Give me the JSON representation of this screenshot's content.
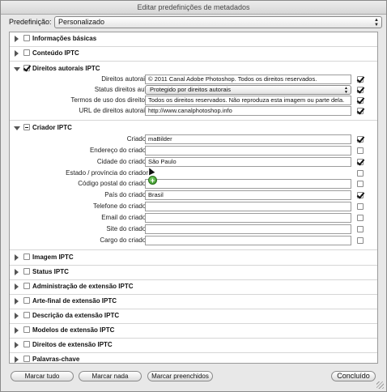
{
  "window": {
    "title": "Editar predefinições de metadados"
  },
  "preset": {
    "label": "Predefinição:",
    "value": "Personalizado"
  },
  "sections_top": [
    {
      "title": "Informações básicas"
    },
    {
      "title": "Conteúdo IPTC"
    }
  ],
  "copyright_section": {
    "title": "Direitos autorais IPTC",
    "fields": [
      {
        "label": "Direitos autorais",
        "value": "© 2011 Canal Adobe Photoshop. Todos os direitos reservados."
      },
      {
        "label": "Status direitos aut.",
        "value": "Protegido por direitos autorais"
      },
      {
        "label": "Termos de uso dos direitos",
        "value": "Todos os direitos reservados. Não reproduza esta imagem ou parte dela."
      },
      {
        "label": "URL de direitos autorais",
        "value": "http://www.canalphotoshop.info"
      }
    ]
  },
  "creator_section": {
    "title": "Criador IPTC",
    "fields": [
      {
        "label": "Criador",
        "value": "maBilder"
      },
      {
        "label": "Endereço do criador",
        "value": ""
      },
      {
        "label": "Cidade do criador",
        "value": "São Paulo"
      },
      {
        "label": "Estado / província do criador",
        "value": ""
      },
      {
        "label": "Código postal do criador",
        "value": ""
      },
      {
        "label": "País do criador",
        "value": "Brasil"
      },
      {
        "label": "Telefone do criador",
        "value": ""
      },
      {
        "label": "Email do criador",
        "value": ""
      },
      {
        "label": "Site do criador",
        "value": ""
      },
      {
        "label": "Cargo do criador",
        "value": ""
      }
    ]
  },
  "sections_bottom": [
    {
      "title": "Imagem IPTC"
    },
    {
      "title": "Status IPTC"
    },
    {
      "title": "Administração de extensão IPTC"
    },
    {
      "title": "Arte-final de extensão IPTC"
    },
    {
      "title": "Descrição da extensão IPTC"
    },
    {
      "title": "Modelos de extensão IPTC"
    },
    {
      "title": "Direitos de extensão IPTC"
    },
    {
      "title": "Palavras-chave"
    }
  ],
  "buttons": {
    "select_all": "Marcar tudo",
    "select_none": "Marcar nada",
    "select_filled": "Marcar preenchidos",
    "done": "Concluído"
  }
}
